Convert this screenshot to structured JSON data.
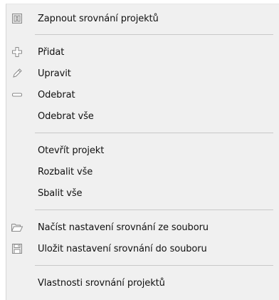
{
  "menu": {
    "items": [
      {
        "label": "Zapnout srovnání projektů",
        "icon": "compare-toggle-icon"
      },
      {
        "label": "Přidat",
        "icon": "plus-icon"
      },
      {
        "label": "Upravit",
        "icon": "pencil-icon"
      },
      {
        "label": "Odebrat",
        "icon": "minus-icon"
      },
      {
        "label": "Odebrat vše",
        "icon": ""
      },
      {
        "label": "Otevřít projekt",
        "icon": ""
      },
      {
        "label": "Rozbalit vše",
        "icon": ""
      },
      {
        "label": "Sbalit vše",
        "icon": ""
      },
      {
        "label": "Načíst nastavení srovnání ze souboru",
        "icon": "folder-open-icon"
      },
      {
        "label": "Uložit nastavení srovnání do souboru",
        "icon": "save-disk-icon"
      },
      {
        "label": "Vlastnosti srovnání projektů",
        "icon": ""
      }
    ]
  },
  "colors": {
    "menu_background": "#f0f0f0",
    "separator": "#c8c8c8",
    "icon_stroke": "#8a8a8a",
    "text": "#111111"
  }
}
